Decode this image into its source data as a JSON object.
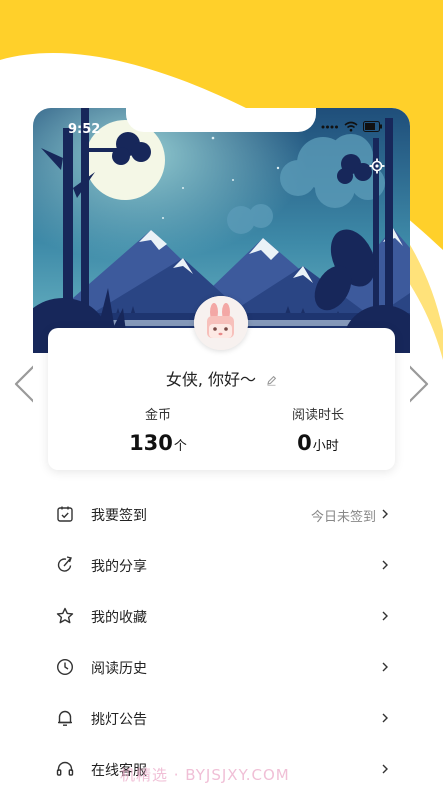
{
  "status_bar": {
    "time": "9:52"
  },
  "profile": {
    "greeting": "女侠, 你好～"
  },
  "stats": {
    "coins": {
      "label": "金币",
      "value": "130",
      "unit": "个"
    },
    "reading": {
      "label": "阅读时长",
      "value": "0",
      "unit": "小时"
    }
  },
  "menu": [
    {
      "icon": "calendar-check-icon",
      "label": "我要签到",
      "extra": "今日未签到"
    },
    {
      "icon": "share-icon",
      "label": "我的分享",
      "extra": ""
    },
    {
      "icon": "star-icon",
      "label": "我的收藏",
      "extra": ""
    },
    {
      "icon": "clock-icon",
      "label": "阅读历史",
      "extra": ""
    },
    {
      "icon": "bell-icon",
      "label": "挑灯公告",
      "extra": ""
    },
    {
      "icon": "headset-icon",
      "label": "在线客服",
      "extra": ""
    }
  ],
  "watermark": "机精选 · BYJSJXY.COM",
  "colors": {
    "accent_yellow": "#FFD02A",
    "pale_yellow": "#FFE27A",
    "scene_sky": "#2E6E96",
    "scene_dark": "#15295A"
  }
}
